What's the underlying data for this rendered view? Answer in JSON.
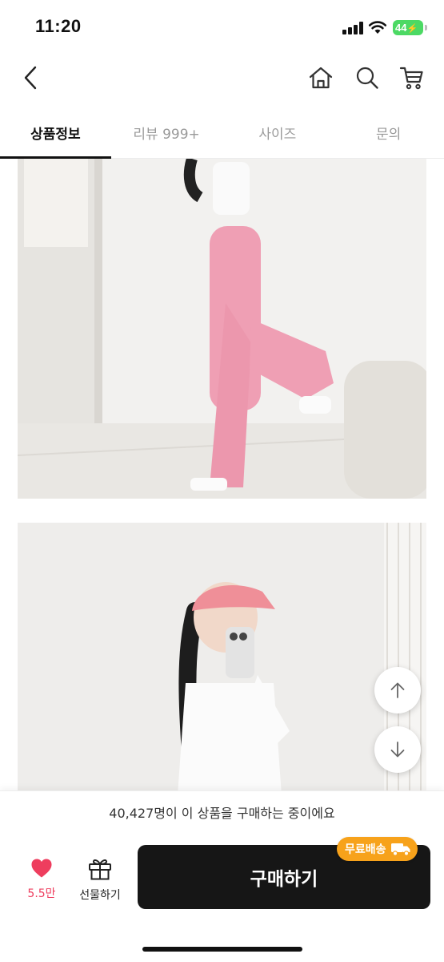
{
  "status_bar": {
    "time": "11:20",
    "battery": "44"
  },
  "header": {
    "back_icon": "chevron-left-icon",
    "home_icon": "home-icon",
    "search_icon": "search-icon",
    "cart_icon": "cart-icon"
  },
  "tabs": [
    {
      "label": "상품정보",
      "active": true
    },
    {
      "label": "리뷰 999+",
      "active": false
    },
    {
      "label": "사이즈",
      "active": false
    },
    {
      "label": "문의",
      "active": false
    }
  ],
  "notice": {
    "text": "40,427명이 이 상품을 구매하는 중이에요"
  },
  "bottom_bar": {
    "like_count": "5.5만",
    "gift_label": "선물하기",
    "buy_label": "구매하기",
    "free_shipping_badge": "무료배송"
  },
  "colors": {
    "like": "#ee3d5e",
    "badge": "#f7a21b",
    "buy_button": "#161616",
    "pants": "#ef9fb4"
  }
}
